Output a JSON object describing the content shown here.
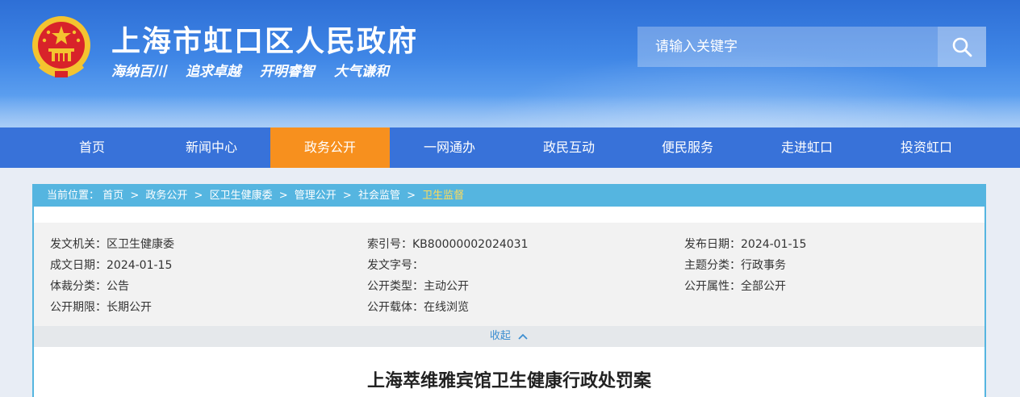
{
  "header": {
    "site_title": "上海市虹口区人民政府",
    "slogan": [
      "海纳百川",
      "追求卓越",
      "开明睿智",
      "大气谦和"
    ]
  },
  "search": {
    "placeholder": "请输入关键字"
  },
  "nav": {
    "items": [
      {
        "label": "首页"
      },
      {
        "label": "新闻中心"
      },
      {
        "label": "政务公开",
        "active": true
      },
      {
        "label": "一网通办"
      },
      {
        "label": "政民互动"
      },
      {
        "label": "便民服务"
      },
      {
        "label": "走进虹口"
      },
      {
        "label": "投资虹口"
      }
    ]
  },
  "breadcrumb": {
    "prefix": "当前位置：",
    "items": [
      "首页",
      "政务公开",
      "区卫生健康委",
      "管理公开",
      "社会监管"
    ],
    "current": "卫生监督",
    "separator": ">"
  },
  "meta": [
    [
      "发文机关：区卫生健康委",
      "索引号：KB80000002024031",
      "发布日期：2024-01-15"
    ],
    [
      "成文日期：2024-01-15",
      "发文字号：",
      "主题分类：行政事务"
    ],
    [
      "体裁分类：公告",
      "公开类型：主动公开",
      "公开属性：全部公开"
    ],
    [
      "公开期限：长期公开",
      "公开载体：在线浏览",
      ""
    ]
  ],
  "collapse_label": "收起",
  "document": {
    "title": "上海萃维雅宾馆卫生健康行政处罚案"
  },
  "colors": {
    "nav_bg": "#3872d9",
    "nav_active": "#f7901e",
    "crumb_bg": "#55b5e0"
  }
}
